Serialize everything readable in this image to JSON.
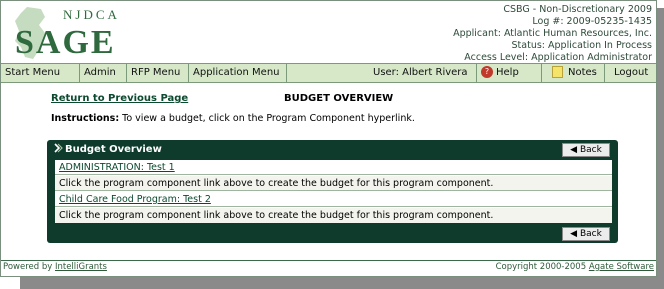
{
  "logo": {
    "small_text": "NJDCA",
    "big_text": "SAGE"
  },
  "header_info": {
    "line1": "CSBG - Non-Discretionary 2009",
    "line2": "Log #: 2009-05235-1435",
    "line3": "Applicant: Atlantic Human Resources, Inc.",
    "line4": "Status: Application In Process",
    "line5": "Access Level: Application Administrator"
  },
  "nav": {
    "start_menu": "Start Menu",
    "admin": "Admin",
    "rfp_menu": "RFP Menu",
    "application_menu": "Application Menu",
    "user": "User: Albert Rivera",
    "help": "Help",
    "notes": "Notes",
    "logout": "Logout"
  },
  "main": {
    "return_link": "Return to Previous Page",
    "page_title": "BUDGET OVERVIEW",
    "instructions_label": "Instructions:",
    "instructions_text": "To view a budget, click on the Program Component hyperlink."
  },
  "panel": {
    "title": "Budget Overview",
    "back_label": "Back",
    "rows": [
      {
        "link": "ADMINISTRATION: Test 1",
        "note": "Click the program component link above to create the budget for this program component."
      },
      {
        "link": "Child Care Food Program: Test 2",
        "note": "Click the program component link above to create the budget for this program component."
      }
    ]
  },
  "footer": {
    "powered_prefix": "Powered by ",
    "powered_link": "IntelliGrants",
    "copyright_prefix": "Copyright 2000-2005 ",
    "copyright_link": "Agate Software"
  },
  "colors": {
    "dark_green": "#0f3b2c",
    "nav_bg": "#d7e8c9",
    "link": "#0b4a2e"
  }
}
